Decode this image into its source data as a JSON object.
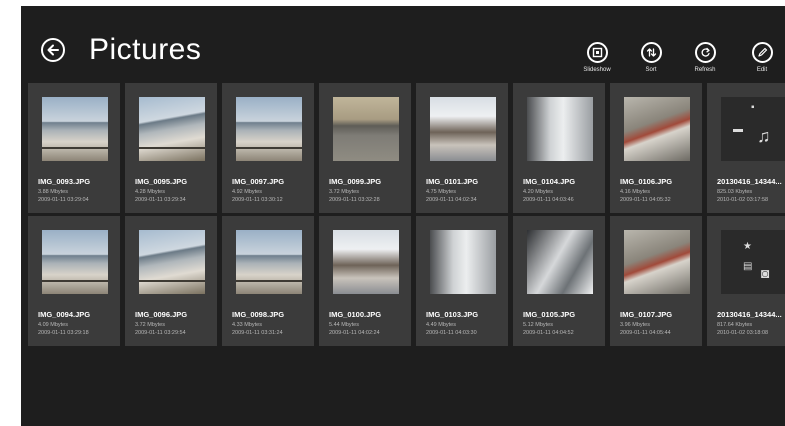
{
  "header": {
    "title": "Pictures",
    "back_icon": "back-arrow-icon"
  },
  "appbar": [
    {
      "label": "Slideshow",
      "icon": "slideshow-icon"
    },
    {
      "label": "Sort",
      "icon": "sort-icon"
    },
    {
      "label": "Refresh",
      "icon": "refresh-icon"
    },
    {
      "label": "Edit",
      "icon": "edit-icon"
    }
  ],
  "tiles": [
    {
      "name": "IMG_0093.JPG",
      "size": "3.88 Mbytes",
      "date": "2009-01-11 03:29:04"
    },
    {
      "name": "IMG_0094.JPG",
      "size": "4.09 Mbytes",
      "date": "2009-01-11 03:29:18"
    },
    {
      "name": "IMG_0095.JPG",
      "size": "4.28 Mbytes",
      "date": "2009-01-11 03:29:34"
    },
    {
      "name": "IMG_0096.JPG",
      "size": "3.72 Mbytes",
      "date": "2009-01-11 03:29:54"
    },
    {
      "name": "IMG_0097.JPG",
      "size": "4.92 Mbytes",
      "date": "2009-01-11 03:30:12"
    },
    {
      "name": "IMG_0098.JPG",
      "size": "4.33 Mbytes",
      "date": "2009-01-11 03:31:24"
    },
    {
      "name": "IMG_0099.JPG",
      "size": "3.72 Mbytes",
      "date": "2009-01-11 03:32:28"
    },
    {
      "name": "IMG_0100.JPG",
      "size": "5.44 Mbytes",
      "date": "2009-01-11 04:02:24"
    },
    {
      "name": "IMG_0101.JPG",
      "size": "4.75 Mbytes",
      "date": "2009-01-11 04:02:34"
    },
    {
      "name": "IMG_0103.JPG",
      "size": "4.49 Mbytes",
      "date": "2009-01-11 04:03:30"
    },
    {
      "name": "IMG_0104.JPG",
      "size": "4.20 Mbytes",
      "date": "2009-01-11 04:03:46"
    },
    {
      "name": "IMG_0105.JPG",
      "size": "5.12 Mbytes",
      "date": "2009-01-11 04:04:52"
    },
    {
      "name": "IMG_0106.JPG",
      "size": "4.16 Mbytes",
      "date": "2009-01-11 04:05:32"
    },
    {
      "name": "IMG_0107.JPG",
      "size": "3.96 Mbytes",
      "date": "2009-01-11 04:05:44"
    },
    {
      "name": "20130416_14344...",
      "size": "825.03 Kbytes",
      "date": "2010-01-02 03:17:58"
    },
    {
      "name": "20130416_14344...",
      "size": "817.64 Kbytes",
      "date": "2010-01-02 03:18:08"
    }
  ],
  "colors": {
    "background": "#1e1e1e",
    "tile": "#3b3b3b",
    "text": "#ffffff",
    "subtext": "#b8b8b8"
  }
}
